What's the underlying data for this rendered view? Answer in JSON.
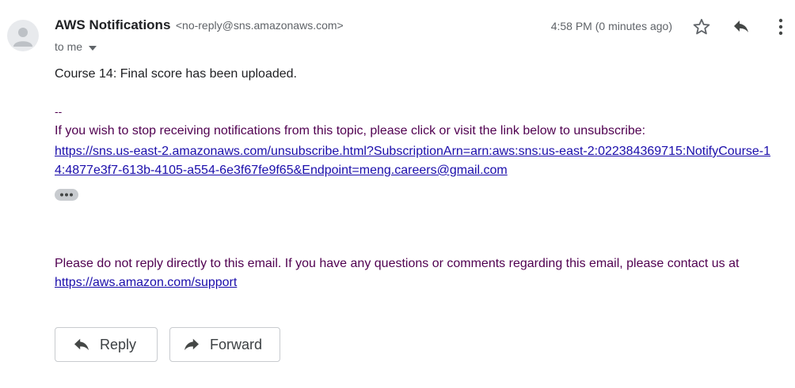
{
  "message": {
    "sender_name": "AWS Notifications",
    "sender_email": "<no-reply@sns.amazonaws.com>",
    "recipient_label": "to me",
    "timestamp": "4:58 PM (0 minutes ago)",
    "body_line": "Course 14: Final score has been uploaded.",
    "signature": {
      "dash": "--",
      "unsubscribe_text": "If you wish to stop receiving notifications from this topic, please click or visit the link below to unsubscribe:",
      "unsubscribe_link": "https://sns.us-east-2.amazonaws.com/unsubscribe.html?SubscriptionArn=arn:aws:sns:us-east-2:022384369715:NotifyCourse-14:4877e3f7-613b-4105-a554-6e3f67fe9f65&Endpoint=meng.careers@gmail.com"
    },
    "notice_text": "Please do not reply directly to this email. If you have any questions or comments regarding this email, please contact us at",
    "support_link": "https://aws.amazon.com/support"
  },
  "actions": {
    "reply_label": "Reply",
    "forward_label": "Forward"
  },
  "icons": {
    "avatar": "person-icon",
    "recipient_caret": "caret-down-icon",
    "star": "star-icon",
    "reply": "reply-icon",
    "more": "more-vertical-icon",
    "show_trimmed": "ellipsis-icon",
    "forward": "forward-icon"
  },
  "colors": {
    "link": "#1a0dab",
    "signature": "#500050",
    "muted": "#5f6368"
  }
}
